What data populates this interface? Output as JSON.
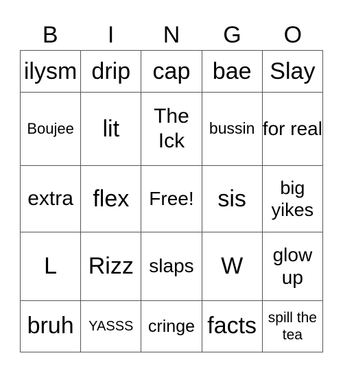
{
  "header": [
    "B",
    "I",
    "N",
    "G",
    "O"
  ],
  "rows": [
    [
      {
        "t": "ilysm",
        "s": 34
      },
      {
        "t": "drip",
        "s": 34
      },
      {
        "t": "cap",
        "s": 34
      },
      {
        "t": "bae",
        "s": 34
      },
      {
        "t": "Slay",
        "s": 34
      }
    ],
    [
      {
        "t": "Boujee",
        "s": 22
      },
      {
        "t": "lit",
        "s": 34
      },
      {
        "t": "The Ick",
        "s": 30
      },
      {
        "t": "bussin",
        "s": 23
      },
      {
        "t": "for real",
        "s": 28
      }
    ],
    [
      {
        "t": "extra",
        "s": 30
      },
      {
        "t": "flex",
        "s": 34
      },
      {
        "t": "Free!",
        "s": 28
      },
      {
        "t": "sis",
        "s": 34
      },
      {
        "t": "big yikes",
        "s": 27
      }
    ],
    [
      {
        "t": "L",
        "s": 34
      },
      {
        "t": "Rizz",
        "s": 34
      },
      {
        "t": "slaps",
        "s": 28
      },
      {
        "t": "W",
        "s": 34
      },
      {
        "t": "glow up",
        "s": 28
      }
    ],
    [
      {
        "t": "bruh",
        "s": 34
      },
      {
        "t": "YASSS",
        "s": 20
      },
      {
        "t": "cringe",
        "s": 25
      },
      {
        "t": "facts",
        "s": 34
      },
      {
        "t": "spill the tea",
        "s": 21
      }
    ]
  ]
}
